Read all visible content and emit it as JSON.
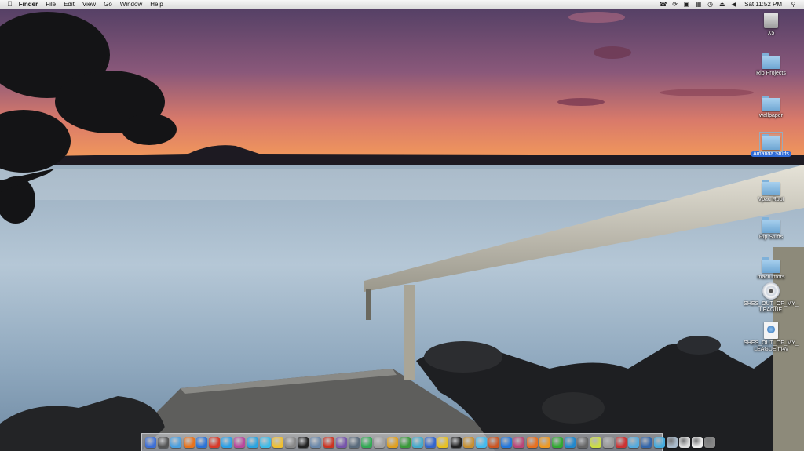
{
  "menubar": {
    "apple_icon": "apple-icon",
    "app_name": "Finder",
    "menus": [
      "File",
      "Edit",
      "View",
      "Go",
      "Window",
      "Help"
    ],
    "status_icons": [
      "skype-status-icon",
      "sync-icon",
      "display-icon",
      "grid-icon",
      "time-machine-icon",
      "eject-icon",
      "volume-icon"
    ],
    "clock": "Sat 11:52 PM",
    "spotlight_icon": "spotlight-search-icon"
  },
  "desktop_icons": [
    {
      "label": "X5",
      "type": "drive",
      "selected": false
    },
    {
      "label": "Rip Projects",
      "type": "folder",
      "selected": false
    },
    {
      "label": "wallpaper",
      "type": "folder",
      "selected": false
    },
    {
      "label": "Amanda Stuffs",
      "type": "folder",
      "selected": true
    },
    {
      "label": "Vpad Root",
      "type": "folder",
      "selected": false
    },
    {
      "label": "Rip Stuffs",
      "type": "folder",
      "selected": false
    },
    {
      "label": "macrumors",
      "type": "folder",
      "selected": false
    },
    {
      "label": "SHES_OUT_OF_MY_LEAGUE",
      "type": "disc",
      "selected": false
    },
    {
      "label": "SHES_OUT_OF_MY_LEAGUE.m4v",
      "type": "file",
      "selected": false
    }
  ],
  "dock": {
    "item_colors": [
      "#3d6fd6",
      "#555555",
      "#4aa0e0",
      "#e8731c",
      "#2a73d8",
      "#d83a2a",
      "#2aa0e8",
      "#b9489c",
      "#2aa4e0",
      "#3dbbe8",
      "#f0c030",
      "#888888",
      "#222222",
      "#6a88aa",
      "#cc3322",
      "#7755aa",
      "#5a6b7c",
      "#33aa55",
      "#a0a0a0",
      "#e0a020",
      "#3a9a3a",
      "#44aacc",
      "#3366cc",
      "#e8c020",
      "#222222",
      "#c89030",
      "#44bbee",
      "#cc5522",
      "#2277dd",
      "#bb4477",
      "#e87020",
      "#ee9922",
      "#33aa33",
      "#2288cc",
      "#666666",
      "#ccdd44",
      "#999999",
      "#cc3333",
      "#55aadd",
      "#3366aa",
      "#44aadd",
      "#aabbcc",
      "#dddddd",
      "#eeeeee",
      "#888888"
    ]
  }
}
